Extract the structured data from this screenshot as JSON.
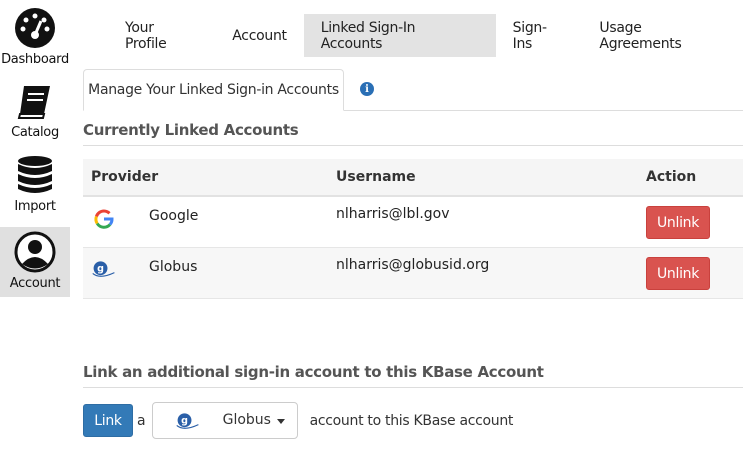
{
  "sidebar": {
    "items": [
      {
        "label": "Dashboard",
        "icon": "dashboard-icon"
      },
      {
        "label": "Catalog",
        "icon": "book-icon"
      },
      {
        "label": "Import",
        "icon": "database-icon"
      },
      {
        "label": "Account",
        "icon": "user-icon",
        "active": true
      }
    ]
  },
  "top_tabs": [
    {
      "label": "Your Profile"
    },
    {
      "label": "Account"
    },
    {
      "label": "Linked Sign-In Accounts",
      "active": true
    },
    {
      "label": "Sign-Ins"
    },
    {
      "label": "Usage Agreements"
    }
  ],
  "subtab": {
    "label": "Manage Your Linked Sign-in Accounts",
    "info_icon": "info-icon",
    "info_glyph": "i"
  },
  "linked": {
    "title": "Currently Linked Accounts",
    "columns": {
      "provider": "Provider",
      "username": "Username",
      "action": "Action"
    },
    "rows": [
      {
        "provider": "Google",
        "username": "nlharris@lbl.gov",
        "action": "Unlink",
        "icon": "google-logo-icon"
      },
      {
        "provider": "Globus",
        "username": "nlharris@globusid.org",
        "action": "Unlink",
        "icon": "globus-logo-icon"
      }
    ]
  },
  "link_section": {
    "title": "Link an additional sign-in account to this KBase Account",
    "button": "Link",
    "word_a": "a",
    "select_value": "Globus",
    "after_text": "account to this KBase account"
  },
  "colors": {
    "unlink": "#d9534f",
    "link": "#337ab7",
    "active_tab": "#e3e3e3"
  }
}
